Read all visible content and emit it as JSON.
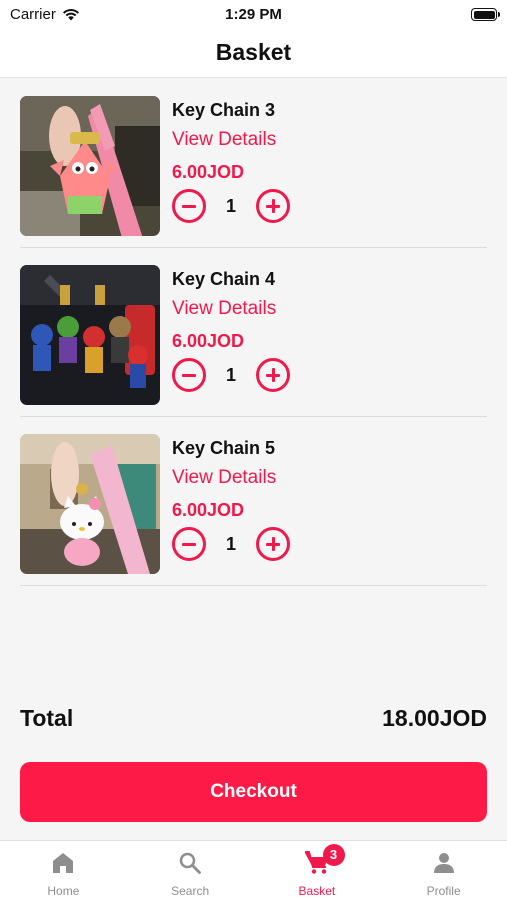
{
  "status_bar": {
    "carrier": "Carrier",
    "time": "1:29 PM"
  },
  "header": {
    "title": "Basket"
  },
  "items": [
    {
      "name": "Key Chain 3",
      "details_label": "View Details",
      "price": "6.00JOD",
      "quantity": "1"
    },
    {
      "name": "Key Chain 4",
      "details_label": "View Details",
      "price": "6.00JOD",
      "quantity": "1"
    },
    {
      "name": "Key Chain 5",
      "details_label": "View Details",
      "price": "6.00JOD",
      "quantity": "1"
    }
  ],
  "summary": {
    "total_label": "Total",
    "total_value": "18.00JOD"
  },
  "checkout_label": "Checkout",
  "tabs": [
    {
      "label": "Home",
      "icon": "home-icon"
    },
    {
      "label": "Search",
      "icon": "search-icon"
    },
    {
      "label": "Basket",
      "icon": "cart-icon",
      "badge": "3",
      "active": true
    },
    {
      "label": "Profile",
      "icon": "person-icon"
    }
  ],
  "colors": {
    "accent": "#f0194b",
    "checkout": "#fd1a47",
    "inactive_tab": "#8e8e8e"
  }
}
